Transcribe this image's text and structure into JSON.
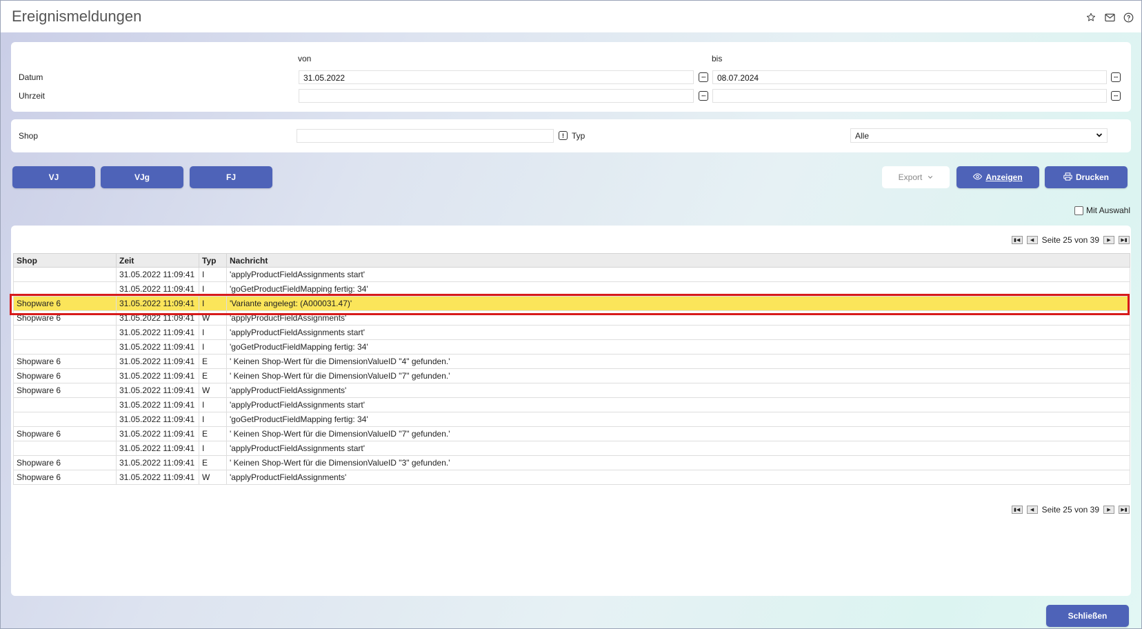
{
  "header": {
    "title": "Ereignismeldungen",
    "icons": [
      "star-icon",
      "mail-icon",
      "help-icon"
    ]
  },
  "filters": {
    "von_label": "von",
    "bis_label": "bis",
    "datum_label": "Datum",
    "uhrzeit_label": "Uhrzeit",
    "datum_von": "31.05.2022",
    "datum_bis": "08.07.2024",
    "uhrzeit_von": "",
    "uhrzeit_bis": "",
    "shop_label": "Shop",
    "shop_value": "",
    "typ_label": "Typ",
    "typ_value": "Alle"
  },
  "buttons": {
    "vj": "VJ",
    "vjg": "VJg",
    "fj": "FJ",
    "export": "Export",
    "anzeigen": "Anzeigen",
    "drucken": "Drucken",
    "schliessen": "Schließen"
  },
  "mit_auswahl": "Mit Auswahl",
  "pager": {
    "text": "Seite 25 von 39"
  },
  "table": {
    "columns": [
      "Shop",
      "Zeit",
      "Typ",
      "Nachricht"
    ],
    "rows": [
      [
        "",
        "31.05.2022 11:09:41",
        "I",
        "'applyProductFieldAssignments start'"
      ],
      [
        "",
        "31.05.2022 11:09:41",
        "I",
        "'goGetProductFieldMapping fertig: 34'"
      ],
      [
        "Shopware 6",
        "31.05.2022 11:09:41",
        "I",
        "'Variante angelegt: (A000031.47)'"
      ],
      [
        "Shopware 6",
        "31.05.2022 11:09:41",
        "W",
        "'applyProductFieldAssignments'"
      ],
      [
        "",
        "31.05.2022 11:09:41",
        "I",
        "'applyProductFieldAssignments start'"
      ],
      [
        "",
        "31.05.2022 11:09:41",
        "I",
        "'goGetProductFieldMapping fertig: 34'"
      ],
      [
        "Shopware 6",
        "31.05.2022 11:09:41",
        "E",
        "' Keinen Shop-Wert für die DimensionValueID \"4\" gefunden.'"
      ],
      [
        "Shopware 6",
        "31.05.2022 11:09:41",
        "E",
        "' Keinen Shop-Wert für die DimensionValueID \"7\" gefunden.'"
      ],
      [
        "Shopware 6",
        "31.05.2022 11:09:41",
        "W",
        "'applyProductFieldAssignments'"
      ],
      [
        "",
        "31.05.2022 11:09:41",
        "I",
        "'applyProductFieldAssignments start'"
      ],
      [
        "",
        "31.05.2022 11:09:41",
        "I",
        "'goGetProductFieldMapping fertig: 34'"
      ],
      [
        "Shopware 6",
        "31.05.2022 11:09:41",
        "E",
        "' Keinen Shop-Wert für die DimensionValueID \"7\" gefunden.'"
      ],
      [
        "",
        "31.05.2022 11:09:41",
        "I",
        "'applyProductFieldAssignments start'"
      ],
      [
        "Shopware 6",
        "31.05.2022 11:09:41",
        "E",
        "' Keinen Shop-Wert für die DimensionValueID \"3\" gefunden.'"
      ],
      [
        "Shopware 6",
        "31.05.2022 11:09:41",
        "W",
        "'applyProductFieldAssignments'"
      ]
    ],
    "selected_row": 2
  },
  "colors": {
    "accent": "#4e63b8",
    "selected_row": "#fbe55a",
    "selection_border": "#d71a1a"
  }
}
